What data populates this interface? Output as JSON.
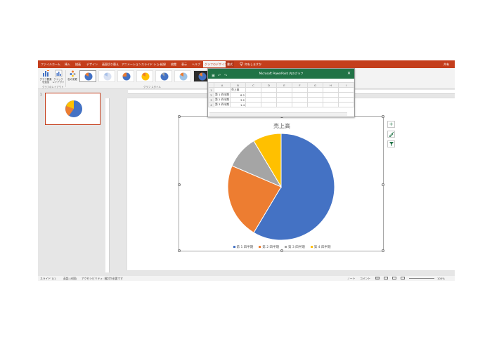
{
  "ribbon_tabs": [
    "ファイル",
    "ホーム",
    "挿入",
    "描画",
    "デザイン",
    "画面切り替え",
    "アニメーション",
    "スライド ショー",
    "記録",
    "校閲",
    "表示",
    "ヘルプ",
    "グラフのデザイン",
    "書式"
  ],
  "tell_me": "何をしますか",
  "share": "共有",
  "ribbon": {
    "add_element": "グラフ要素を追加",
    "quick_layout": "クイック レイアウト",
    "change_colors": "色の変更",
    "group_layout": "グラフのレイアウト",
    "group_styles": "グラフ スタイル"
  },
  "slide_number": "1",
  "excel": {
    "title": "Microsoft PowerPoint 内のグラフ",
    "columns": [
      "A",
      "B",
      "C",
      "D",
      "E",
      "F",
      "G",
      "H",
      "I"
    ],
    "rows": [
      {
        "n": "1",
        "a": "",
        "b": "売上高"
      },
      {
        "n": "2",
        "a": "第 1 四半期",
        "b": "8.2"
      },
      {
        "n": "3",
        "a": "第 2 四半期",
        "b": "3.2"
      },
      {
        "n": "4",
        "a": "第 3 四半期",
        "b": "1.4"
      }
    ]
  },
  "chart_data": {
    "type": "pie",
    "title": "売上高",
    "categories": [
      "第 1 四半期",
      "第 2 四半期",
      "第 3 四半期",
      "第 4 四半期"
    ],
    "values": [
      8.2,
      3.2,
      1.4,
      1.2
    ],
    "colors": [
      "#4472c4",
      "#ed7d31",
      "#a5a5a5",
      "#ffc000"
    ],
    "legend_position": "bottom"
  },
  "status": {
    "slide": "スライド 1/1",
    "language": "英語 (米国)",
    "accessibility": "アクセシビリティ: 検討が必要です",
    "notes": "ノート",
    "comments": "コメント",
    "zoom": "105%"
  }
}
